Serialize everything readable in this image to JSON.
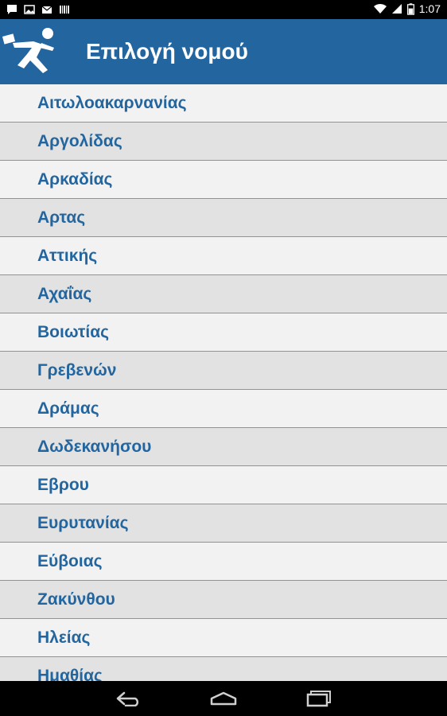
{
  "status_bar": {
    "time": "1:07"
  },
  "app_bar": {
    "title": "Επιλογή νομού"
  },
  "prefectures": [
    "Αιτωλοακαρνανίας",
    "Αργολίδας",
    "Αρκαδίας",
    "Αρτας",
    "Αττικής",
    "Αχαΐας",
    "Βοιωτίας",
    "Γρεβενών",
    "Δράμας",
    "Δωδεκανήσου",
    "Εβρου",
    "Ευρυτανίας",
    "Εύβοιας",
    "Ζακύνθου",
    "Ηλείας",
    "Ημαθίας"
  ],
  "colors": {
    "accent": "#23669f",
    "row_light": "#f2f2f2",
    "row_dark": "#e2e2e2",
    "divider": "#7c98b0"
  }
}
